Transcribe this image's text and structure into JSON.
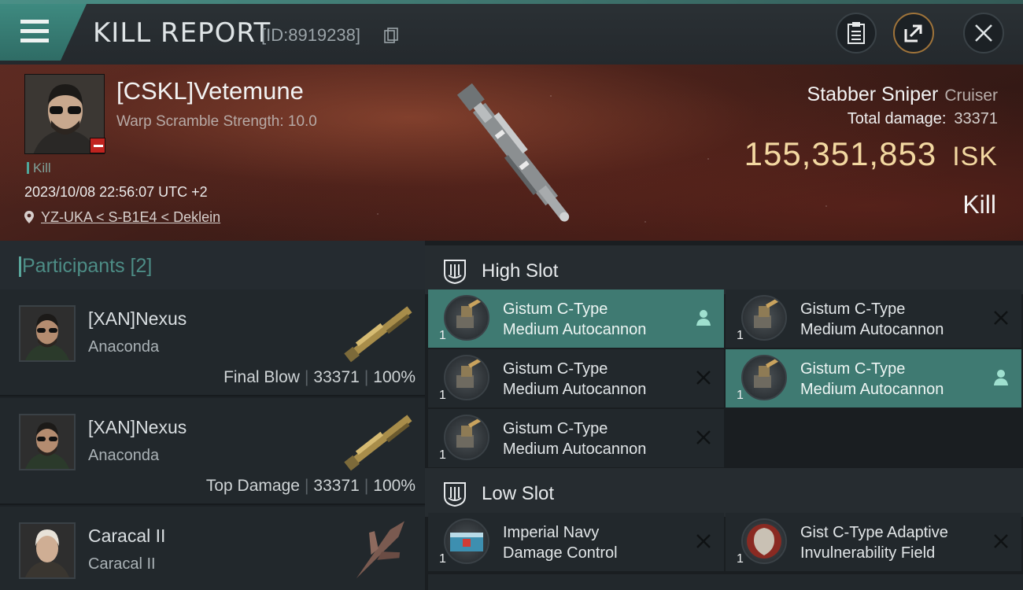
{
  "topbar": {
    "title": "KILL REPORT",
    "report_id": "[ID:8919238]"
  },
  "victim": {
    "name": "[CSKL]Vetemune",
    "warp_scramble": "Warp Scramble Strength: 10.0",
    "kill_tag": "Kill",
    "datetime": "2023/10/08 22:56:07 UTC +2",
    "location": "YZ-UKA < S-B1E4 < Deklein",
    "ship_name": "Stabber Sniper",
    "ship_class": "Cruiser",
    "total_damage_label": "Total damage:",
    "total_damage_value": "33371",
    "isk_value": "155,351,853",
    "isk_unit": "ISK",
    "result": "Kill"
  },
  "participants": {
    "header": "Participants [2]",
    "rows": [
      {
        "name": "[XAN]Nexus",
        "ship": "Anaconda",
        "role": "Final Blow",
        "damage": "33371",
        "percent": "100%"
      },
      {
        "name": "[XAN]Nexus",
        "ship": "Anaconda",
        "role": "Top Damage",
        "damage": "33371",
        "percent": "100%"
      },
      {
        "name": "Caracal II",
        "ship": "Caracal II"
      }
    ]
  },
  "fitting": {
    "high_slot": {
      "label": "High Slot",
      "modules": [
        {
          "line1": "Gistum C-Type",
          "line2": "Medium Autocannon",
          "qty": "1",
          "active": true
        },
        {
          "line1": "Gistum C-Type",
          "line2": "Medium Autocannon",
          "qty": "1",
          "active": false
        },
        {
          "line1": "Gistum C-Type",
          "line2": "Medium Autocannon",
          "qty": "1",
          "active": false
        },
        {
          "line1": "Gistum C-Type",
          "line2": "Medium Autocannon",
          "qty": "1",
          "active": true
        },
        {
          "line1": "Gistum C-Type",
          "line2": "Medium Autocannon",
          "qty": "1",
          "active": false
        }
      ]
    },
    "low_slot": {
      "label": "Low Slot",
      "modules": [
        {
          "line1": "Imperial Navy",
          "line2": "Damage Control",
          "qty": "1",
          "active": false
        },
        {
          "line1": "Gist C-Type Adaptive",
          "line2": "Invulnerability Field",
          "qty": "1",
          "active": false
        }
      ]
    }
  },
  "colors": {
    "accent_teal": "#3f7a72",
    "isk_gold": "#f3d8a1",
    "badge_red": "#c0231f"
  },
  "icons": [
    "menu-icon",
    "copy-icon",
    "clipboard-icon",
    "share-icon",
    "close-icon",
    "location-pin-icon",
    "slot-icon",
    "person-icon",
    "dismiss-icon"
  ]
}
